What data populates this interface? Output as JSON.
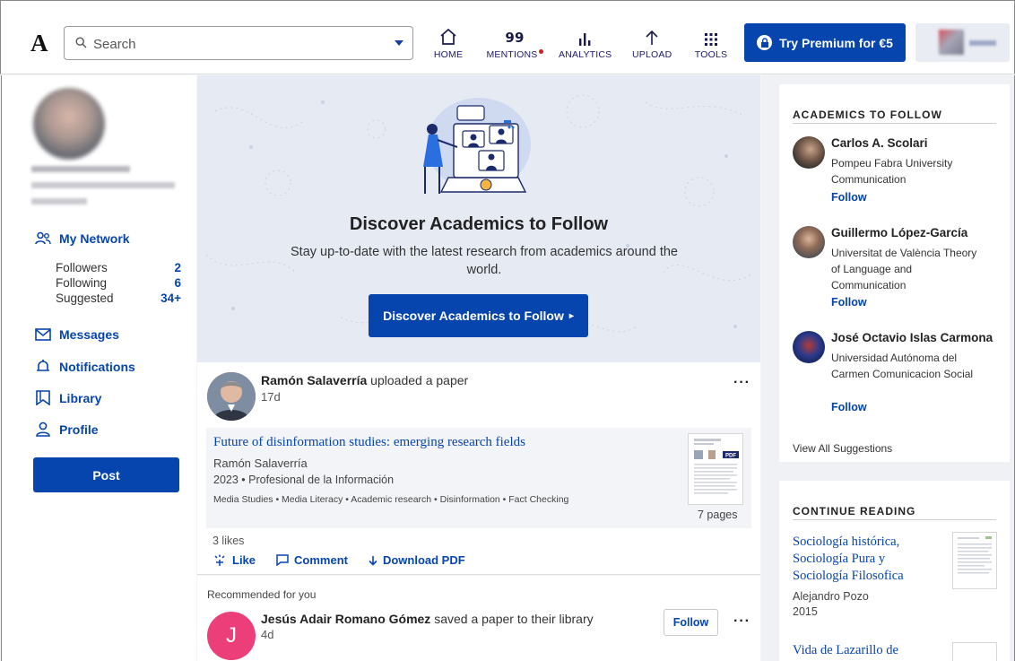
{
  "header": {
    "logo": "A",
    "search_placeholder": "Search",
    "nav": [
      {
        "label": "HOME"
      },
      {
        "label": "MENTIONS"
      },
      {
        "label": "ANALYTICS"
      },
      {
        "label": "UPLOAD"
      },
      {
        "label": "TOOLS"
      }
    ],
    "premium_label": "Try Premium for €5"
  },
  "left": {
    "nav": {
      "my_network": "My Network",
      "messages": "Messages",
      "notifications": "Notifications",
      "library": "Library",
      "profile": "Profile"
    },
    "stats": [
      {
        "label": "Followers",
        "value": "2"
      },
      {
        "label": "Following",
        "value": "6"
      },
      {
        "label": "Suggested",
        "value": "34+"
      }
    ],
    "post_label": "Post"
  },
  "hero": {
    "title": "Discover Academics to Follow",
    "subtitle": "Stay up-to-date with the latest research from academics around the world.",
    "button": "Discover Academics to Follow",
    "button_arrow": "▸"
  },
  "feed": {
    "author": "Ramón Salaverría",
    "action": " uploaded a paper",
    "time": "17d",
    "more": "···",
    "paper": {
      "title": "Future of disinformation studies: emerging research fields",
      "author": "Ramón Salaverría",
      "meta": "2023 • Profesional de la Información",
      "tags": "Media Studies • Media Literacy • Academic research • Disinformation • Fact Checking",
      "pages": "7 pages",
      "pdf_badge": "PDF"
    },
    "likes": "3 likes",
    "actions": {
      "like": "Like",
      "comment": "Comment",
      "download": "Download PDF"
    }
  },
  "recommended": {
    "label": "Recommended for you",
    "initial": "J",
    "author": "Jesús Adair Romano Gómez",
    "action": " saved a paper to their library",
    "time": "4d",
    "follow": "Follow",
    "more": "···"
  },
  "academics_panel": {
    "title": "ACADEMICS TO FOLLOW",
    "people": [
      {
        "name": "Carlos A. Scolari",
        "affiliation": "Pompeu Fabra University Communication",
        "follow": "Follow"
      },
      {
        "name": "Guillermo López-García",
        "affiliation": "Universitat de València Theory of Language and Communication",
        "follow": "Follow"
      },
      {
        "name": "José Octavio Islas Carmona",
        "affiliation": "Universidad Autónoma del Carmen Comunicacion Social",
        "follow": "Follow"
      }
    ],
    "view_all": "View All Suggestions"
  },
  "continue_reading": {
    "title": "CONTINUE READING",
    "items": [
      {
        "title": "Sociología histórica, Sociología Pura y Sociología Filosofica",
        "author": "Alejandro Pozo",
        "year": "2015"
      },
      {
        "title": "Vida de Lazarillo de"
      }
    ]
  },
  "colors": {
    "brand": "#0645ad",
    "hero_bg": "#e5eaf3",
    "mention_dot": "#d21d1d"
  }
}
